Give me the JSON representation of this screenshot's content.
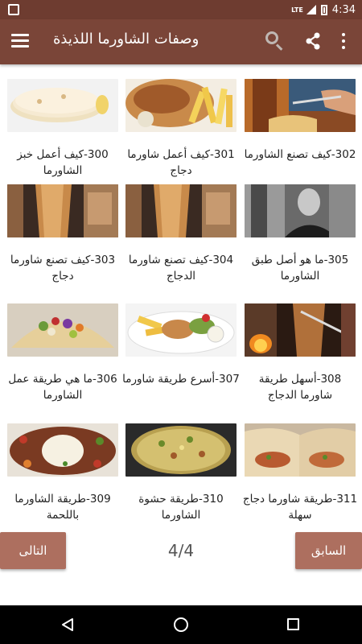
{
  "app": {
    "title": "وصفات الشاورما اللذيذة",
    "accent_color": "#7a4538",
    "statusbar_color": "#6e3c30",
    "button_color": "#ad6f5f"
  },
  "statusbar": {
    "time": "4:34",
    "network": "LTE",
    "icons": [
      "notification-icon",
      "lte-signal-icon",
      "battery-icon"
    ]
  },
  "toolbar": {
    "icons": [
      "menu-icon",
      "search-icon",
      "share-icon",
      "more-options-icon"
    ]
  },
  "recipes": [
    {
      "caption": "300-كيف أعمل خبز الشاورما",
      "thumb": "flatbread-image"
    },
    {
      "caption": "301-كيف أعمل شاورما دجاج",
      "thumb": "shawarma-plate-fries-image"
    },
    {
      "caption": "302-كيف تصنع الشاورما",
      "thumb": "shawarma-spit-cutting-image"
    },
    {
      "caption": "303-كيف تصنع شاورما دجاج",
      "thumb": "chicken-spit-image"
    },
    {
      "caption": "304-كيف تصنع شاورما الدجاج",
      "thumb": "chicken-spit-image-2"
    },
    {
      "caption": "305-ما هو أصل طبق الشاورما",
      "thumb": "chef-portrait-image"
    },
    {
      "caption": "306-ما هي طريقة عمل الشاورما",
      "thumb": "shawarma-wrap-salad-image"
    },
    {
      "caption": "307-أسرع طريقة شاورما",
      "thumb": "shawarma-plate-garlic-image"
    },
    {
      "caption": "308-أسهل طريقة شاورما الدجاج",
      "thumb": "spit-fire-image"
    },
    {
      "caption": "309-طريقة الشاورما باللحمة",
      "thumb": "meat-plate-sauce-image"
    },
    {
      "caption": "310-طريقة حشوة الشاورما",
      "thumb": "shawarma-filling-pan-image"
    },
    {
      "caption": "311-طريقة شاورما دجاج سهلة",
      "thumb": "rolled-wraps-image"
    }
  ],
  "pagination": {
    "next_label": "التالى",
    "prev_label": "السابق",
    "page_indicator": "4/4"
  },
  "navbar": {
    "icons": [
      "back-icon",
      "home-icon",
      "recent-apps-icon"
    ]
  }
}
